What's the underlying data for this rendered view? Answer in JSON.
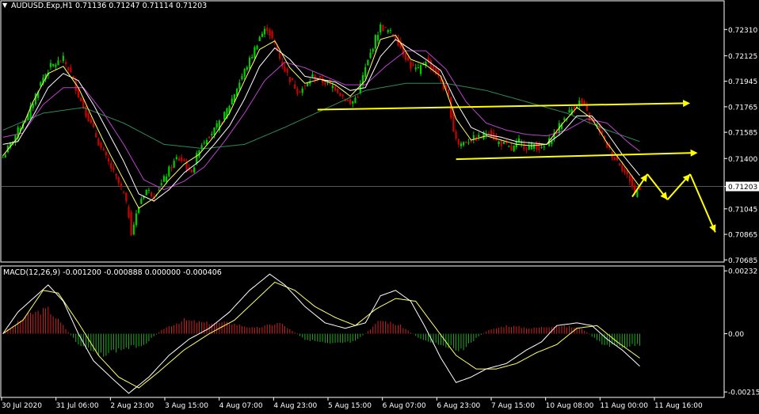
{
  "chart_header": {
    "symbol_marker": "▼",
    "symbol_text": "AUDUSD.Exp,H1  0.71136 0.71247 0.71114 0.71203",
    "macd_label": "MACD(12,26,9) -0.001200 -0.000888 0.000000 -0.000406"
  },
  "colors": {
    "background": "#000000",
    "frame": "#ffffff",
    "bull_candle": "#00cc00",
    "bear_candle": "#cc0000",
    "ma_fast": "#ffff66",
    "ma_mid": "#ffffff",
    "ma_slow": "#bb44cc",
    "ma_long": "#2e8b57",
    "annotation": "#ffff00",
    "macd_pos": "#cc2222",
    "macd_neg": "#22aa22",
    "macd_main": "#ffffff",
    "macd_signal": "#ffff66"
  },
  "chart_data": [
    {
      "type": "candlestick",
      "title": "AUDUSD.Exp,H1",
      "ohlc_last": {
        "open": 0.71136,
        "high": 0.71247,
        "low": 0.71114,
        "close": 0.71203
      },
      "y_ticks": [
        0.7231,
        0.72125,
        0.71945,
        0.71765,
        0.71585,
        0.714,
        0.71203,
        0.71045,
        0.70865,
        0.70685
      ],
      "current_price": 0.71203,
      "ylim": [
        0.7067,
        0.7244
      ],
      "x_tick_labels": [
        "30 Jul 2020",
        "31 Jul 06:00",
        "2 Aug 23:00",
        "3 Aug 15:00",
        "4 Aug 07:00",
        "4 Aug 23:00",
        "5 Aug 15:00",
        "6 Aug 07:00",
        "6 Aug 23:00",
        "7 Aug 15:00",
        "10 Aug 08:00",
        "11 Aug 00:00",
        "11 Aug 16:00"
      ],
      "close_path": [
        [
          0,
          0.7141
        ],
        [
          3,
          0.715
        ],
        [
          7,
          0.7163
        ],
        [
          10,
          0.717
        ],
        [
          13,
          0.7185
        ],
        [
          16,
          0.7197
        ],
        [
          19,
          0.7205
        ],
        [
          22,
          0.7208
        ],
        [
          24,
          0.721
        ],
        [
          27,
          0.72
        ],
        [
          30,
          0.7185
        ],
        [
          33,
          0.7172
        ],
        [
          36,
          0.716
        ],
        [
          39,
          0.7147
        ],
        [
          42,
          0.7137
        ],
        [
          45,
          0.7126
        ],
        [
          48,
          0.7115
        ],
        [
          50,
          0.71
        ],
        [
          51,
          0.7088
        ],
        [
          53,
          0.71
        ],
        [
          55,
          0.7112
        ],
        [
          57,
          0.7118
        ],
        [
          60,
          0.7114
        ],
        [
          63,
          0.7122
        ],
        [
          66,
          0.7132
        ],
        [
          69,
          0.714
        ],
        [
          72,
          0.7138
        ],
        [
          74,
          0.713
        ],
        [
          76,
          0.7135
        ],
        [
          78,
          0.7148
        ],
        [
          81,
          0.7155
        ],
        [
          84,
          0.716
        ],
        [
          87,
          0.7167
        ],
        [
          90,
          0.7178
        ],
        [
          93,
          0.719
        ],
        [
          96,
          0.7202
        ],
        [
          99,
          0.7213
        ],
        [
          102,
          0.7226
        ],
        [
          105,
          0.7232
        ],
        [
          108,
          0.722
        ],
        [
          111,
          0.7206
        ],
        [
          114,
          0.7196
        ],
        [
          117,
          0.7188
        ],
        [
          120,
          0.719
        ],
        [
          123,
          0.7198
        ],
        [
          126,
          0.7195
        ],
        [
          129,
          0.7193
        ],
        [
          132,
          0.719
        ],
        [
          135,
          0.7184
        ],
        [
          138,
          0.7178
        ],
        [
          141,
          0.7185
        ],
        [
          143,
          0.7198
        ],
        [
          146,
          0.7214
        ],
        [
          148,
          0.7225
        ],
        [
          150,
          0.7233
        ],
        [
          153,
          0.723
        ],
        [
          156,
          0.7226
        ],
        [
          159,
          0.7215
        ],
        [
          162,
          0.7205
        ],
        [
          165,
          0.7202
        ],
        [
          168,
          0.721
        ],
        [
          171,
          0.7203
        ],
        [
          174,
          0.7195
        ],
        [
          177,
          0.7182
        ],
        [
          179,
          0.716
        ],
        [
          181,
          0.715
        ],
        [
          184,
          0.7152
        ],
        [
          187,
          0.7154
        ],
        [
          190,
          0.7155
        ],
        [
          193,
          0.716
        ],
        [
          196,
          0.7152
        ],
        [
          199,
          0.715
        ],
        [
          202,
          0.7146
        ],
        [
          205,
          0.7152
        ],
        [
          208,
          0.7148
        ],
        [
          211,
          0.715
        ],
        [
          214,
          0.7146
        ],
        [
          217,
          0.7152
        ],
        [
          220,
          0.716
        ],
        [
          223,
          0.7168
        ],
        [
          226,
          0.7175
        ],
        [
          229,
          0.718
        ],
        [
          231,
          0.7176
        ],
        [
          233,
          0.7168
        ],
        [
          235,
          0.7165
        ],
        [
          237,
          0.716
        ],
        [
          239,
          0.7152
        ],
        [
          241,
          0.7146
        ],
        [
          243,
          0.714
        ],
        [
          245,
          0.7137
        ],
        [
          247,
          0.713
        ],
        [
          249,
          0.7125
        ],
        [
          251,
          0.7115
        ],
        [
          253,
          0.712
        ]
      ],
      "ma_fast_path": [
        [
          0,
          0.7142
        ],
        [
          6,
          0.7155
        ],
        [
          12,
          0.718
        ],
        [
          18,
          0.72
        ],
        [
          24,
          0.7205
        ],
        [
          30,
          0.719
        ],
        [
          36,
          0.7167
        ],
        [
          42,
          0.7145
        ],
        [
          48,
          0.7125
        ],
        [
          54,
          0.7105
        ],
        [
          60,
          0.7112
        ],
        [
          66,
          0.7125
        ],
        [
          72,
          0.7136
        ],
        [
          78,
          0.7143
        ],
        [
          84,
          0.7156
        ],
        [
          90,
          0.7172
        ],
        [
          96,
          0.7195
        ],
        [
          102,
          0.7217
        ],
        [
          108,
          0.7223
        ],
        [
          114,
          0.7204
        ],
        [
          120,
          0.7193
        ],
        [
          126,
          0.7196
        ],
        [
          132,
          0.7192
        ],
        [
          138,
          0.7184
        ],
        [
          144,
          0.7195
        ],
        [
          150,
          0.7224
        ],
        [
          156,
          0.7227
        ],
        [
          162,
          0.721
        ],
        [
          168,
          0.7206
        ],
        [
          174,
          0.7198
        ],
        [
          180,
          0.7168
        ],
        [
          186,
          0.7153
        ],
        [
          192,
          0.7156
        ],
        [
          198,
          0.7153
        ],
        [
          204,
          0.715
        ],
        [
          210,
          0.7149
        ],
        [
          216,
          0.715
        ],
        [
          222,
          0.7164
        ],
        [
          228,
          0.7176
        ],
        [
          234,
          0.7168
        ],
        [
          240,
          0.7151
        ],
        [
          246,
          0.7137
        ],
        [
          253,
          0.712
        ]
      ],
      "ma_mid_path": [
        [
          0,
          0.715
        ],
        [
          6,
          0.7152
        ],
        [
          12,
          0.717
        ],
        [
          18,
          0.719
        ],
        [
          24,
          0.72
        ],
        [
          30,
          0.7195
        ],
        [
          36,
          0.7178
        ],
        [
          42,
          0.7158
        ],
        [
          48,
          0.7138
        ],
        [
          54,
          0.7115
        ],
        [
          60,
          0.711
        ],
        [
          66,
          0.7118
        ],
        [
          72,
          0.713
        ],
        [
          78,
          0.7138
        ],
        [
          84,
          0.715
        ],
        [
          90,
          0.7163
        ],
        [
          96,
          0.7182
        ],
        [
          102,
          0.7205
        ],
        [
          108,
          0.7218
        ],
        [
          114,
          0.721
        ],
        [
          120,
          0.7198
        ],
        [
          126,
          0.7196
        ],
        [
          132,
          0.7194
        ],
        [
          138,
          0.7188
        ],
        [
          144,
          0.719
        ],
        [
          150,
          0.7212
        ],
        [
          156,
          0.7224
        ],
        [
          162,
          0.7217
        ],
        [
          168,
          0.721
        ],
        [
          174,
          0.7202
        ],
        [
          180,
          0.718
        ],
        [
          186,
          0.7162
        ],
        [
          192,
          0.7157
        ],
        [
          198,
          0.7155
        ],
        [
          204,
          0.7152
        ],
        [
          210,
          0.7151
        ],
        [
          216,
          0.715
        ],
        [
          222,
          0.7158
        ],
        [
          228,
          0.717
        ],
        [
          234,
          0.717
        ],
        [
          240,
          0.7158
        ],
        [
          246,
          0.7143
        ],
        [
          253,
          0.7128
        ]
      ],
      "ma_slow_path": [
        [
          0,
          0.7155
        ],
        [
          8,
          0.7158
        ],
        [
          16,
          0.7178
        ],
        [
          24,
          0.719
        ],
        [
          32,
          0.719
        ],
        [
          40,
          0.7172
        ],
        [
          48,
          0.715
        ],
        [
          56,
          0.7125
        ],
        [
          64,
          0.7118
        ],
        [
          72,
          0.7124
        ],
        [
          80,
          0.7134
        ],
        [
          88,
          0.7152
        ],
        [
          96,
          0.7172
        ],
        [
          104,
          0.7195
        ],
        [
          112,
          0.7208
        ],
        [
          120,
          0.7204
        ],
        [
          128,
          0.7198
        ],
        [
          136,
          0.7192
        ],
        [
          144,
          0.7192
        ],
        [
          152,
          0.7205
        ],
        [
          160,
          0.7216
        ],
        [
          168,
          0.7216
        ],
        [
          176,
          0.7203
        ],
        [
          184,
          0.718
        ],
        [
          192,
          0.7165
        ],
        [
          200,
          0.716
        ],
        [
          208,
          0.7157
        ],
        [
          216,
          0.7156
        ],
        [
          224,
          0.716
        ],
        [
          232,
          0.7168
        ],
        [
          240,
          0.7165
        ],
        [
          248,
          0.7152
        ],
        [
          253,
          0.7145
        ]
      ],
      "ma_long_path": [
        [
          0,
          0.716
        ],
        [
          16,
          0.7172
        ],
        [
          32,
          0.7176
        ],
        [
          48,
          0.7165
        ],
        [
          64,
          0.715
        ],
        [
          80,
          0.7147
        ],
        [
          96,
          0.715
        ],
        [
          112,
          0.7162
        ],
        [
          128,
          0.7175
        ],
        [
          144,
          0.7188
        ],
        [
          160,
          0.7193
        ],
        [
          176,
          0.7193
        ],
        [
          192,
          0.7188
        ],
        [
          208,
          0.718
        ],
        [
          224,
          0.7172
        ],
        [
          240,
          0.716
        ],
        [
          253,
          0.7152
        ]
      ],
      "trend_lines": [
        {
          "from": [
            125,
            0.71745
          ],
          "to": [
            273,
            0.7179
          ]
        },
        {
          "from": [
            180,
            0.71395
          ],
          "to": [
            276,
            0.7144
          ]
        }
      ],
      "forecast_path": [
        [
          250,
          0.7113
        ],
        [
          256,
          0.7129
        ],
        [
          264,
          0.7111
        ],
        [
          273,
          0.7129
        ],
        [
          283,
          0.7088
        ]
      ]
    },
    {
      "type": "histogram",
      "title": "MACD(12,26,9)",
      "values": {
        "main": -0.0012,
        "signal": -0.000888,
        "zero": 0.0,
        "hist": -0.000406
      },
      "y_ticks": [
        0.00232,
        0.0,
        -0.00215
      ],
      "ylim": [
        -0.00235,
        0.0025
      ],
      "hist_path": [
        [
          0,
          0.0
        ],
        [
          10,
          0.0007
        ],
        [
          18,
          0.0009
        ],
        [
          24,
          0.0003
        ],
        [
          30,
          -0.0004
        ],
        [
          38,
          -0.0008
        ],
        [
          46,
          -0.0006
        ],
        [
          56,
          -0.0004
        ],
        [
          64,
          0.0002
        ],
        [
          72,
          0.0005
        ],
        [
          80,
          0.0004
        ],
        [
          90,
          0.0004
        ],
        [
          100,
          0.0002
        ],
        [
          110,
          0.0004
        ],
        [
          120,
          -0.0002
        ],
        [
          130,
          -0.0004
        ],
        [
          140,
          -0.0003
        ],
        [
          150,
          0.0005
        ],
        [
          158,
          0.0003
        ],
        [
          166,
          -0.0002
        ],
        [
          174,
          -0.0004
        ],
        [
          182,
          -0.0006
        ],
        [
          192,
          0.0001
        ],
        [
          200,
          0.0003
        ],
        [
          210,
          0.0002
        ],
        [
          220,
          0.0003
        ],
        [
          230,
          0.0002
        ],
        [
          238,
          -0.0004
        ],
        [
          246,
          -0.0005
        ],
        [
          253,
          -0.0004
        ]
      ],
      "main_path": [
        [
          0,
          0.0
        ],
        [
          6,
          0.0008
        ],
        [
          12,
          0.0013
        ],
        [
          18,
          0.0018
        ],
        [
          24,
          0.0012
        ],
        [
          30,
          0.0
        ],
        [
          36,
          -0.001
        ],
        [
          44,
          -0.0017
        ],
        [
          50,
          -0.0022
        ],
        [
          58,
          -0.0016
        ],
        [
          66,
          -0.0008
        ],
        [
          74,
          -0.0002
        ],
        [
          82,
          0.0002
        ],
        [
          90,
          0.0008
        ],
        [
          98,
          0.0016
        ],
        [
          106,
          0.0022
        ],
        [
          112,
          0.0018
        ],
        [
          120,
          0.001
        ],
        [
          128,
          0.0004
        ],
        [
          136,
          0.0002
        ],
        [
          144,
          0.0004
        ],
        [
          150,
          0.0014
        ],
        [
          156,
          0.0016
        ],
        [
          162,
          0.0012
        ],
        [
          168,
          0.0002
        ],
        [
          174,
          -0.0009
        ],
        [
          180,
          -0.0018
        ],
        [
          186,
          -0.0016
        ],
        [
          192,
          -0.0013
        ],
        [
          200,
          -0.0011
        ],
        [
          208,
          -0.0006
        ],
        [
          214,
          -0.0003
        ],
        [
          220,
          0.0003
        ],
        [
          228,
          0.0004
        ],
        [
          234,
          0.0003
        ],
        [
          240,
          -0.0002
        ],
        [
          246,
          -0.0006
        ],
        [
          253,
          -0.0012
        ]
      ],
      "signal_path": [
        [
          0,
          0.0
        ],
        [
          8,
          0.0005
        ],
        [
          16,
          0.0016
        ],
        [
          22,
          0.0015
        ],
        [
          30,
          0.0004
        ],
        [
          38,
          -0.0008
        ],
        [
          46,
          -0.0016
        ],
        [
          54,
          -0.002
        ],
        [
          62,
          -0.0014
        ],
        [
          72,
          -0.0006
        ],
        [
          82,
          0.0
        ],
        [
          92,
          0.0005
        ],
        [
          100,
          0.0012
        ],
        [
          108,
          0.0019
        ],
        [
          116,
          0.0016
        ],
        [
          124,
          0.001
        ],
        [
          132,
          0.0006
        ],
        [
          140,
          0.0003
        ],
        [
          148,
          0.0009
        ],
        [
          156,
          0.0013
        ],
        [
          164,
          0.0012
        ],
        [
          172,
          0.0002
        ],
        [
          180,
          -0.0008
        ],
        [
          188,
          -0.0013
        ],
        [
          196,
          -0.0013
        ],
        [
          204,
          -0.0011
        ],
        [
          212,
          -0.0007
        ],
        [
          220,
          -0.0004
        ],
        [
          228,
          0.0002
        ],
        [
          236,
          0.0003
        ],
        [
          244,
          -0.0003
        ],
        [
          253,
          -0.0009
        ]
      ]
    }
  ]
}
